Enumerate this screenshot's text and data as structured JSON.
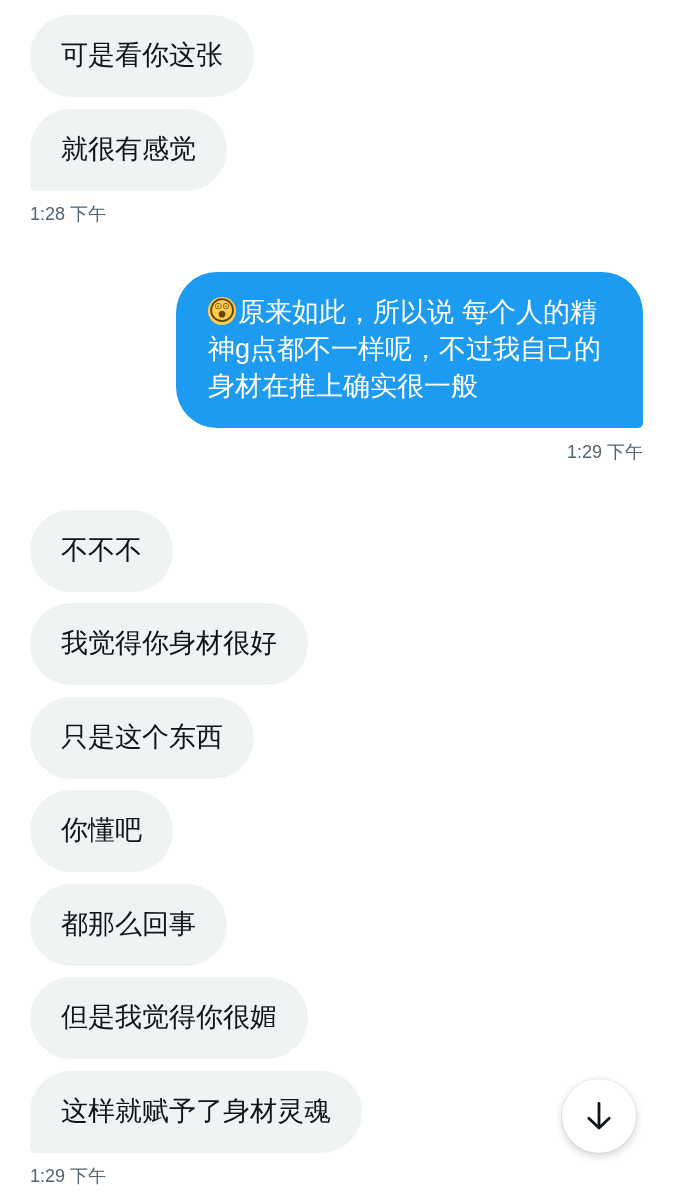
{
  "conversation": {
    "groups": [
      {
        "kind": "received",
        "messages": [
          "可是看你这张",
          "就很有感觉"
        ],
        "time": "1:28 下午"
      },
      {
        "kind": "sent",
        "messages": [
          "😲原来如此，所以说 每个人的精神g点都不一样呢，不过我自己的身材在推上确实很一般"
        ],
        "time": "1:29 下午"
      },
      {
        "kind": "received",
        "messages": [
          "不不不",
          "我觉得你身材很好",
          "只是这个东西",
          "你懂吧",
          "都那么回事",
          "但是我觉得你很媚",
          "这样就赋予了身材灵魂"
        ],
        "time": "1:29 下午"
      }
    ]
  }
}
